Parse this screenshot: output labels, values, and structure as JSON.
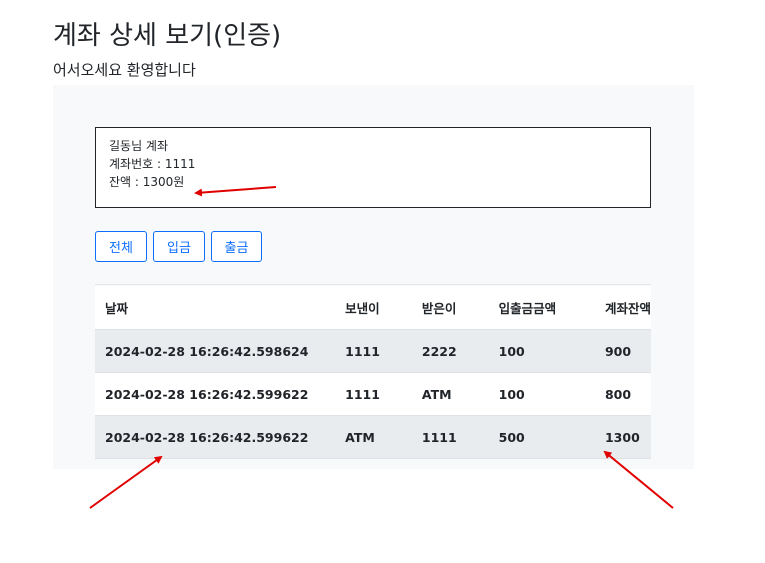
{
  "page": {
    "title": "계좌 상세 보기(인증)",
    "subtitle": "어서오세요 환영합니다"
  },
  "account": {
    "owner_line": "길동님 계좌",
    "number_line": "계좌번호 : 1111",
    "balance_line": "잔액 : 1300원"
  },
  "filters": {
    "all": "전체",
    "deposit": "입금",
    "withdraw": "출금"
  },
  "table": {
    "headers": [
      "날짜",
      "보낸이",
      "받은이",
      "입출금금액",
      "계좌잔액"
    ],
    "rows": [
      [
        "2024-02-28 16:26:42.598624",
        "1111",
        "2222",
        "100",
        "900"
      ],
      [
        "2024-02-28 16:26:42.599622",
        "1111",
        "ATM",
        "100",
        "800"
      ],
      [
        "2024-02-28 16:26:42.599622",
        "ATM",
        "1111",
        "500",
        "1300"
      ]
    ]
  },
  "colors": {
    "accent": "#0d6efd",
    "annotation_arrow": "#e00000",
    "panel_bg": "#f8f9fa",
    "striped_row": "#e9ecef"
  }
}
